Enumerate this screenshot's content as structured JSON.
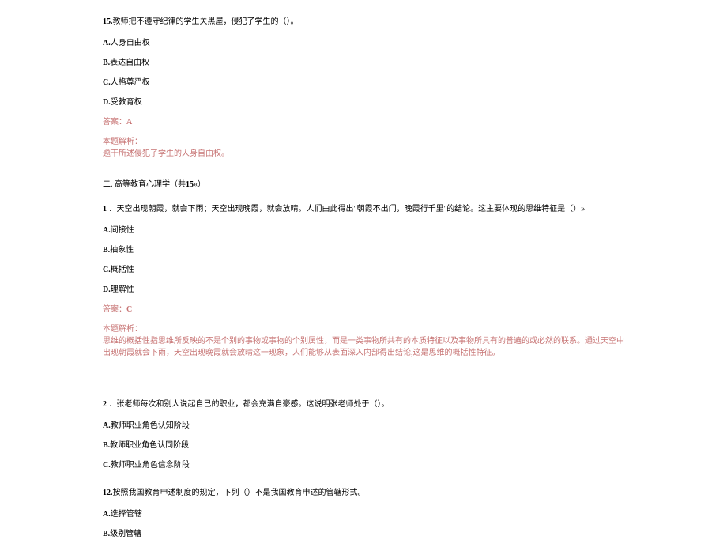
{
  "q15": {
    "num": "15.",
    "text": "教师把不遵守纪律的学生关黑屋，侵犯了学生的（）。",
    "opts": {
      "a_label": "A.",
      "a_text": "人身自由权",
      "b_label": "B.",
      "b_text": "表达自由权",
      "c_label": "C.",
      "c_text": "人格尊严权",
      "d_label": "D.",
      "d_text": "受教育权"
    },
    "answer_label": "答案：",
    "answer_value": "A",
    "analysis_label": "本题解析：",
    "analysis_text": "题干所述侵犯了学生的人身自由权。"
  },
  "section2": {
    "title_prefix": "二. 高等教育心理学（共",
    "title_num": "15",
    "title_suffix": "«）"
  },
  "q1": {
    "num": "1",
    "text": " ．天空出现朝霞，就会下雨；天空出现晚霞，就会放晴。人们由此得出\"朝霞不出门，晚霞行千里''的结论。这主要体现的思维特征是（）»",
    "opts": {
      "a_label": "A.",
      "a_text": "间接性",
      "b_label": "B.",
      "b_text": "抽象性",
      "c_label": "C.",
      "c_text": "概括性",
      "d_label": "D.",
      "d_text": "理解性"
    },
    "answer_label": "答案：",
    "answer_value": "C",
    "analysis_label": "本题解析：",
    "analysis_text": "思维的概括性指思维所反映的不是个别的事物或事物的个别属性，而是一类事物所共有的本质特征以及事物所具有的普遍的或必然的联系。通过天空中出现朝霞就会下雨，天空出现晚霞就会放晴这一现象，人们能够从表面深入内部得出结论,这是思维的概括性特征。"
  },
  "q2": {
    "num": "2",
    "text": " ．张老师每次和别人说起自己的职业，都会充满自豪感。这说明张老师处于（）。",
    "opts": {
      "a_label": "A.",
      "a_text": "教师职业角色认知阶段",
      "b_label": "B.",
      "b_text": "教师职业角色认同阶段",
      "c_label": "C.",
      "c_text": "教师职业角色信念阶段"
    }
  },
  "q12": {
    "num": "12.",
    "text": "按照我国教育申述制度的规定，下列（）不是我国教育申述的管辖形式。",
    "opts": {
      "a_label": "A.",
      "a_text": "选择管辖",
      "b_label": "B.",
      "b_text": "级别管辖"
    }
  }
}
